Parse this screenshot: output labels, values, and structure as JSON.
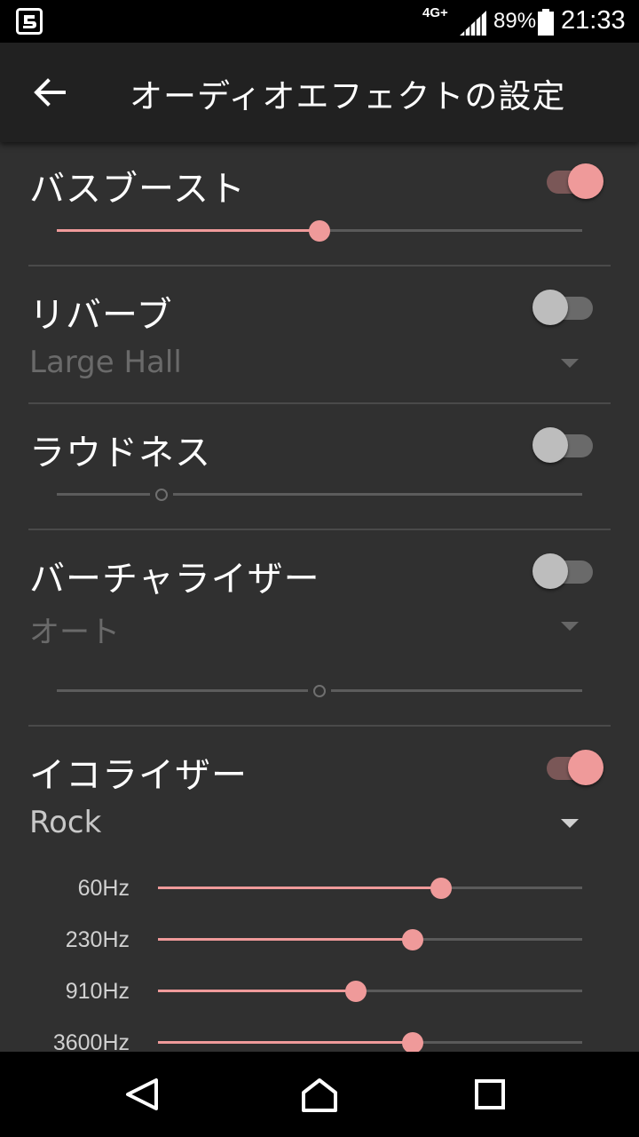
{
  "status_bar": {
    "app_icon": "notification-app-icon",
    "network": "4G+",
    "battery_percent": "89%",
    "time": "21:33",
    "battery_level": 0.89
  },
  "app_bar": {
    "back_icon": "arrow-back-icon",
    "title": "オーディオエフェクトの設定"
  },
  "sections": {
    "bass_boost": {
      "title": "バスブースト",
      "enabled": true,
      "level": 0.5
    },
    "reverb": {
      "title": "リバーブ",
      "enabled": false,
      "preset": "Large Hall"
    },
    "loudness": {
      "title": "ラウドネス",
      "enabled": false,
      "level": 0.2
    },
    "virtualizer": {
      "title": "バーチャライザー",
      "enabled": false,
      "mode": "オート",
      "level": 0.5
    },
    "equalizer": {
      "title": "イコライザー",
      "enabled": true,
      "preset": "Rock",
      "bands": [
        {
          "label": "60Hz",
          "level": 0.667
        },
        {
          "label": "230Hz",
          "level": 0.6
        },
        {
          "label": "910Hz",
          "level": 0.467
        },
        {
          "label": "3600Hz",
          "level": 0.6
        }
      ]
    }
  },
  "colors": {
    "accent": "#ef9a9a",
    "background": "#303030",
    "app_bar": "#212121"
  },
  "nav_bar": {
    "back_icon": "nav-back-icon",
    "home_icon": "nav-home-icon",
    "recents_icon": "nav-recents-icon"
  }
}
